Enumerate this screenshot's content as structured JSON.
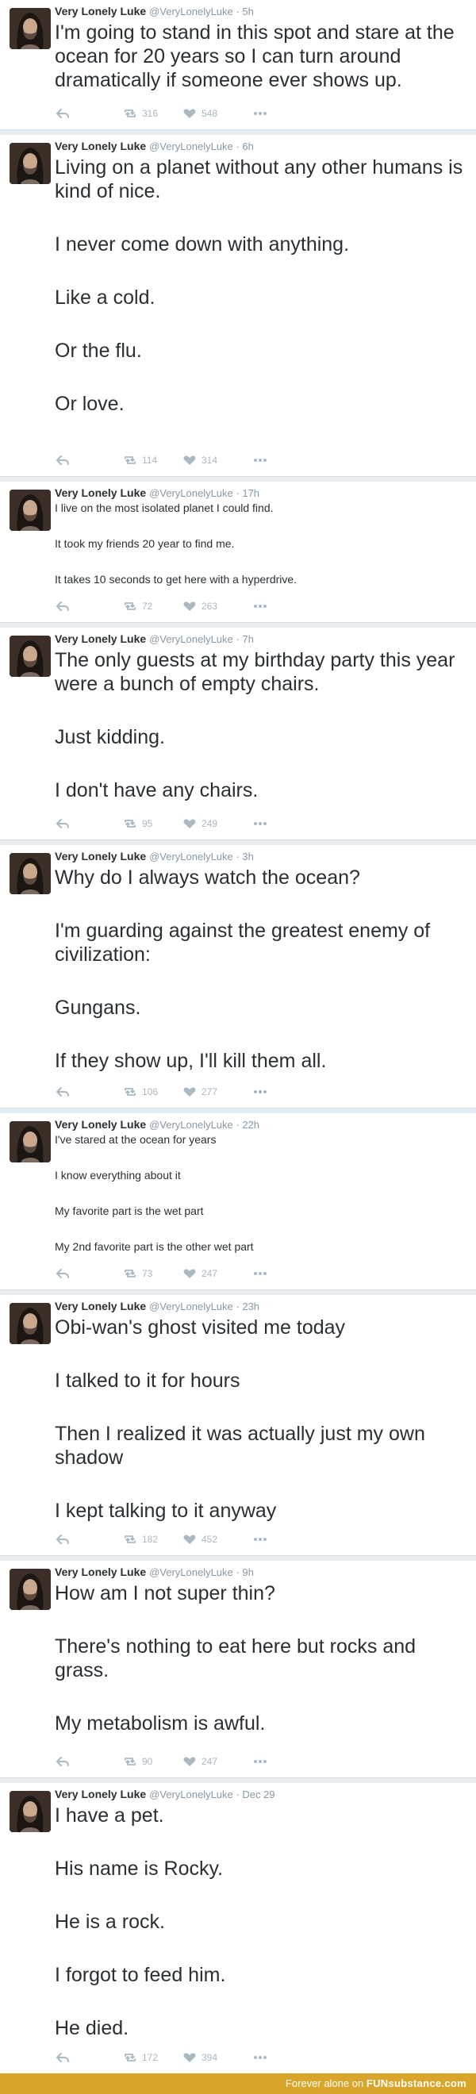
{
  "user": {
    "name": "Very Lonely Luke",
    "handle": "@VeryLonelyLuke"
  },
  "colors": {
    "accent_footer": "#d9a52a",
    "action_gray": "#aab8c2",
    "separator": "#e6ecf0"
  },
  "icons": {
    "reply": "reply-icon",
    "retweet": "retweet-icon",
    "like": "heart-icon",
    "more": "more-icon"
  },
  "tweets": [
    {
      "time": "5h",
      "lines": [
        "I'm going to stand in this spot and stare at the ocean for 20 years so I can turn around dramatically if someone ever shows up."
      ],
      "retweets": "316",
      "likes": "548"
    },
    {
      "time": "6h",
      "lines": [
        "Living on a planet without any other humans is kind of nice.",
        "I never come down with anything.",
        "Like a cold.",
        "Or the flu.",
        "Or love."
      ],
      "retweets": "114",
      "likes": "314"
    },
    {
      "time": "17h",
      "lines": [
        "I live on the most isolated planet I could find.",
        "It took my friends 20 year to find me.",
        "It takes 10 seconds to get here with a hyperdrive."
      ],
      "retweets": "72",
      "likes": "263"
    },
    {
      "time": "7h",
      "lines": [
        "The only guests at my birthday party this year were a bunch of empty chairs.",
        "Just kidding.",
        "I don't have any chairs."
      ],
      "retweets": "95",
      "likes": "249"
    },
    {
      "time": "3h",
      "lines": [
        "Why do I always watch the ocean?",
        "I'm guarding against the greatest enemy of civilization:",
        "Gungans.",
        "If they show up, I'll kill them all."
      ],
      "retweets": "106",
      "likes": "277"
    },
    {
      "time": "22h",
      "lines": [
        "I've stared at the ocean for years",
        "I know everything about it",
        "My favorite part is the wet part",
        "My 2nd favorite part is the other wet part"
      ],
      "retweets": "73",
      "likes": "247"
    },
    {
      "time": "23h",
      "lines": [
        "Obi-wan's ghost visited me today",
        "I talked to it for hours",
        "Then I realized it was actually just my own shadow",
        "I kept talking to it anyway"
      ],
      "retweets": "182",
      "likes": "452"
    },
    {
      "time": "9h",
      "lines": [
        "How am I not super thin?",
        "There's nothing to eat here but rocks and grass.",
        "My metabolism is awful."
      ],
      "retweets": "90",
      "likes": "247"
    },
    {
      "time": "Dec 29",
      "lines": [
        "I have a pet.",
        "His name is Rocky.",
        "He is a rock.",
        "I forgot to feed him.",
        "He died."
      ],
      "retweets": "172",
      "likes": "394"
    }
  ],
  "footer": {
    "text": "Forever alone on",
    "brand": "FUNsubstance.com"
  }
}
